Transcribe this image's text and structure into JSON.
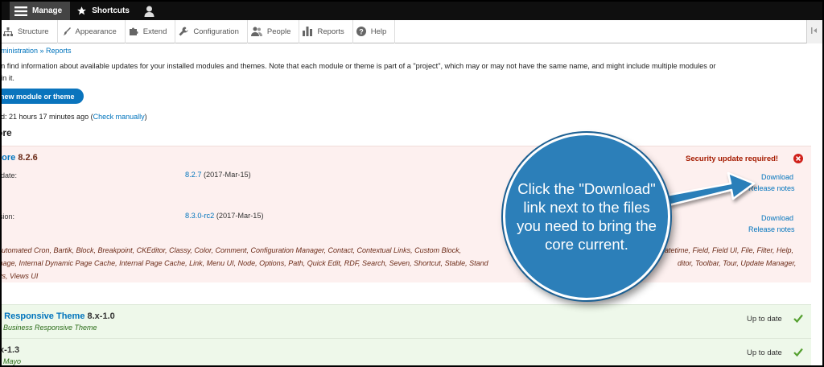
{
  "toolbar": {
    "manage_label": "Manage",
    "shortcuts_label": "Shortcuts",
    "tray": [
      {
        "label": "Structure",
        "icon": "sitemap-icon"
      },
      {
        "label": "Appearance",
        "icon": "wrench-icon"
      },
      {
        "label": "Extend",
        "icon": "puzzle-icon"
      },
      {
        "label": "Configuration",
        "icon": "wrench-icon"
      },
      {
        "label": "People",
        "icon": "people-icon"
      },
      {
        "label": "Reports",
        "icon": "bar-chart-icon"
      },
      {
        "label": "Help",
        "icon": "help-icon"
      }
    ]
  },
  "breadcrumb": "dministration » Reports",
  "description_line1": "an find information about available updates for your installed modules and themes. Note that each module or theme is part of a \"project\", which may or may not have the same name, and might include multiple modules or",
  "description_line2": "hin it.",
  "install_button": "new module or theme",
  "last_checked": {
    "prefix": "ed: 21 hours 17 minutes ago (",
    "link": "Check manually",
    "suffix": ")"
  },
  "section_title": "ore",
  "core": {
    "name": "core",
    "version": "8.2.6",
    "status": "Security update required!",
    "status_color": "#a51b00",
    "rows": [
      {
        "label": "pdate:",
        "version": "8.2.7",
        "date": "(2017-Mar-15)",
        "download": "Download",
        "release_notes": "Release notes"
      },
      {
        "label": "rsion:",
        "version": "8.3.0-rc2",
        "date": "(2017-Mar-15)",
        "download": "Download",
        "release_notes": "Release notes"
      }
    ],
    "includes_line1": "Automated Cron, Bartik, Block, Breakpoint, CKEditor, Classy, Color, Comment, Configuration Manager, Contact, Contextual Links, Custom Block,",
    "includes_line1_right": "atetime, Field, Field UI, File, Filter, Help,",
    "includes_line2": "mage, Internal Dynamic Page Cache, Internal Page Cache, Link, Menu UI, Node, Options, Path, Quick Edit, RDF, Search, Seven, Shortcut, Stable, Stand",
    "includes_line2_right": "ditor, Toolbar, Tour, Update Manager,",
    "includes_line3": "ws, Views UI"
  },
  "projects": [
    {
      "name": "s Responsive Theme",
      "version": "8.x-1.0",
      "subtitle": "Business Responsive Theme",
      "status": "Up to date"
    },
    {
      "name": "",
      "version": ".x-1.3",
      "subtitle": "Mayo",
      "status": "Up to date"
    }
  ],
  "callout_text": "Click the \"Download\" link next to the files you need to bring the core current.",
  "colors": {
    "accent": "#0074bd",
    "callout": "#2c7fb9",
    "ok_bg": "#eef8ea",
    "error_bg": "#fdf0ef"
  }
}
